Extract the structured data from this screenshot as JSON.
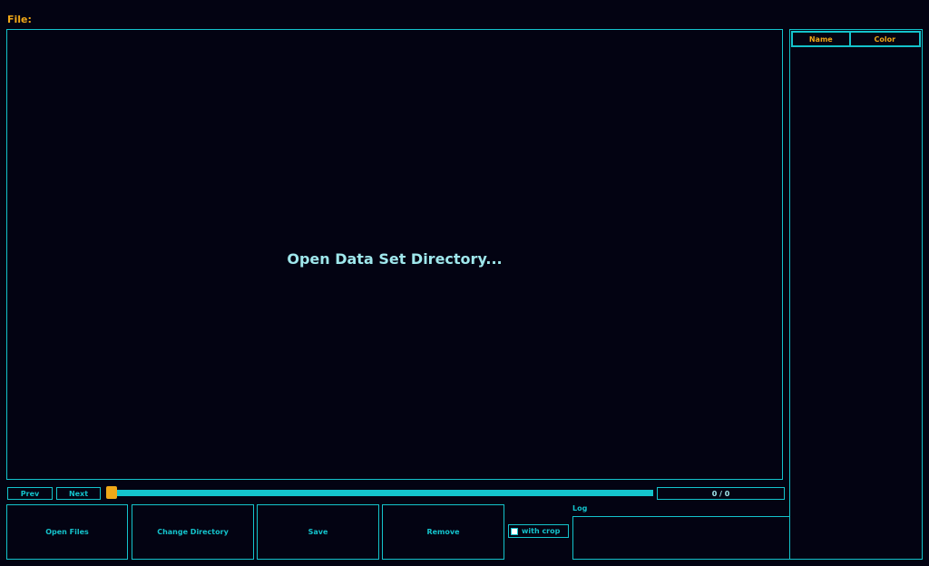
{
  "header": {
    "file_label": "File:"
  },
  "canvas": {
    "message": "Open Data Set Directory..."
  },
  "labels_table": {
    "columns": [
      "Name",
      "Color"
    ]
  },
  "navigation": {
    "prev_label": "Prev",
    "next_label": "Next",
    "counter": "0 / 0",
    "slider_position": 0
  },
  "actions": {
    "open_files": "Open Files",
    "change_directory": "Change Directory",
    "save": "Save",
    "remove": "Remove",
    "with_crop_label": "with crop",
    "with_crop_checked": false
  },
  "log": {
    "label": "Log",
    "content": ""
  },
  "colors": {
    "background": "#030312",
    "accent_cyan": "#14c3cc",
    "accent_orange": "#f0a818",
    "light_text": "#9fe7ec"
  }
}
